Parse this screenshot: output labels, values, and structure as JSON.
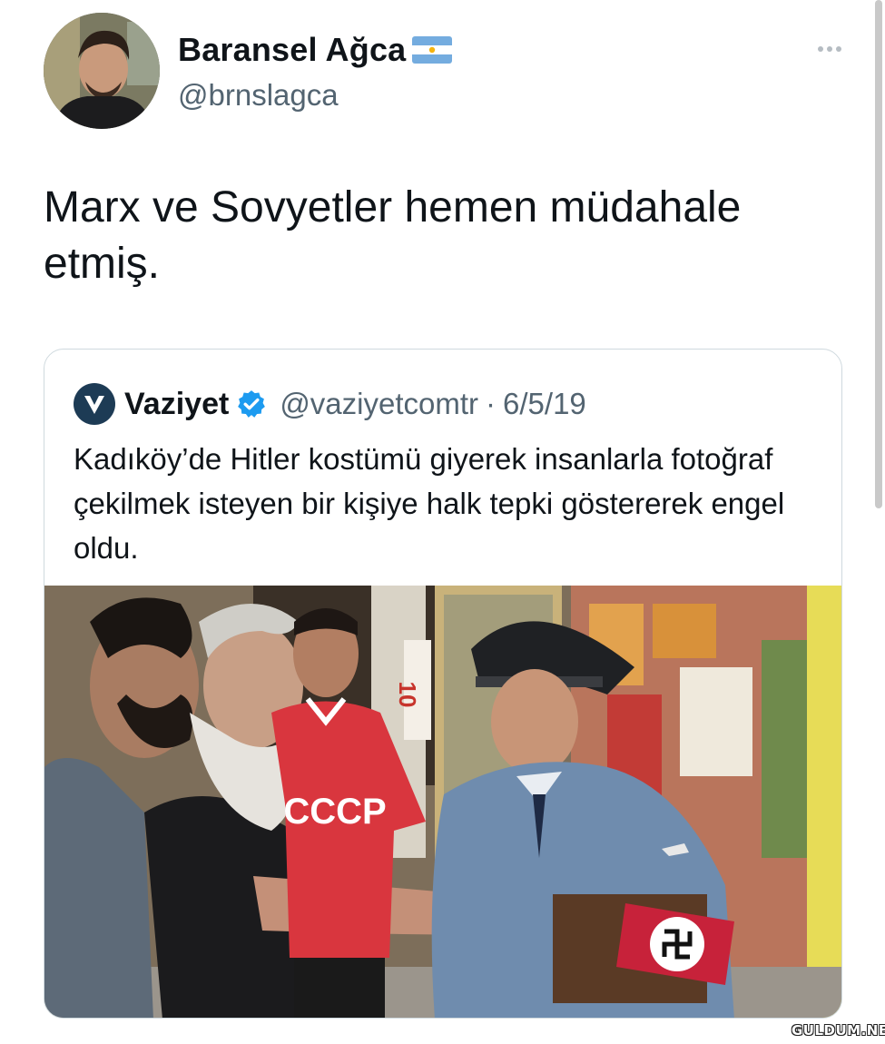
{
  "tweet": {
    "author": {
      "display_name": "Baransel Ağca",
      "handle": "@brnslagca",
      "avatar_icon": "user-avatar",
      "flag_icon": "argentina-flag-icon"
    },
    "text": "Marx ve Sovyetler hemen müdahale etmiş.",
    "more_icon": "more-horizontal-icon"
  },
  "quoted_tweet": {
    "author": {
      "display_name": "Vaziyet",
      "handle": "@vaziyetcomtr",
      "avatar_icon": "vaziyet-logo",
      "verified_icon": "verified-badge-icon"
    },
    "separator": "·",
    "date": "6/5/19",
    "text": "Kadıköy’de Hitler kostümü giyerek insanlarla fotoğraf çekilmek isteyen bir kişiye halk tepki göstererek engel oldu.",
    "image": {
      "shirt_text": "CCCP",
      "sign_text": "10"
    }
  },
  "watermark": "GULDUM.NET",
  "colors": {
    "text_primary": "#0f1419",
    "text_secondary": "#536471",
    "border": "#cfd9de",
    "verified": "#1d9bf0",
    "brand_vaziyet": "#1d3b55"
  }
}
